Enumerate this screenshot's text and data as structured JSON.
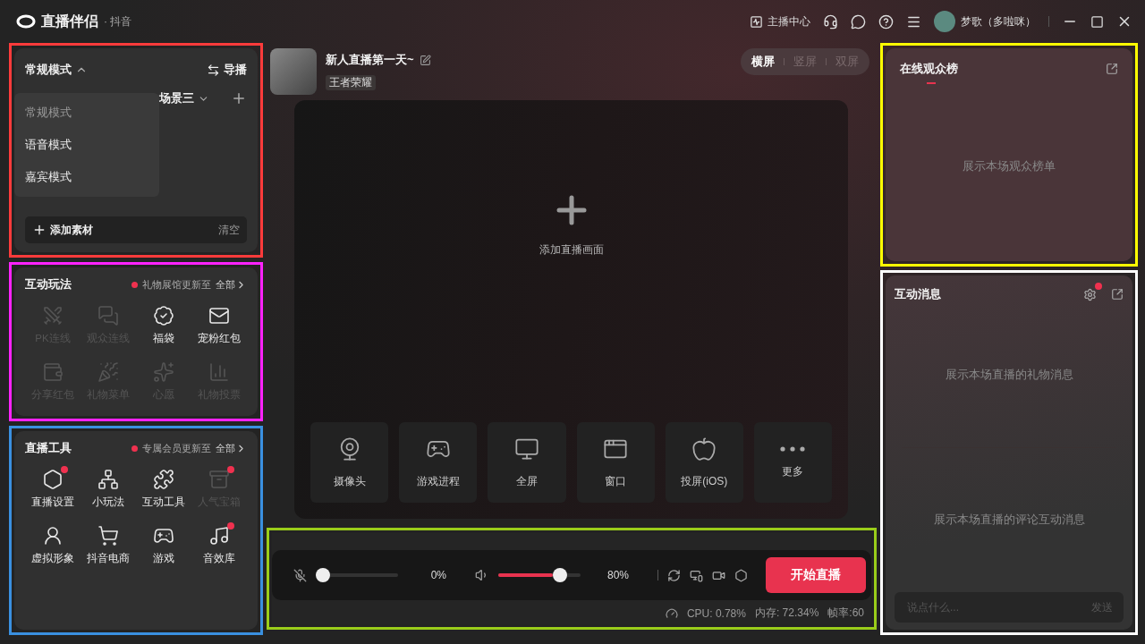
{
  "titlebar": {
    "app_name": "直播伴侣",
    "platform": "· 抖音",
    "anchor_center": "主播中心",
    "user_name": "梦歌（多啦咪）"
  },
  "scene_panel": {
    "mode": "常规模式",
    "mode_menu_expanded": true,
    "director": "导播",
    "scene_tab": "场景三",
    "mode_menu": [
      {
        "label": "常规模式",
        "selected": true
      },
      {
        "label": "语音模式",
        "selected": false
      },
      {
        "label": "嘉宾模式",
        "selected": false
      }
    ],
    "add_material": "添加素材",
    "clear": "清空"
  },
  "interactive_panel": {
    "title": "互动玩法",
    "notice": "礼物展馆更新至",
    "all": "全部",
    "items": [
      {
        "label": "PK连线",
        "disabled": true,
        "badge": false
      },
      {
        "label": "观众连线",
        "disabled": true,
        "badge": false
      },
      {
        "label": "福袋",
        "disabled": false,
        "badge": false
      },
      {
        "label": "宠粉红包",
        "disabled": false,
        "badge": false
      },
      {
        "label": "分享红包",
        "disabled": true,
        "badge": false
      },
      {
        "label": "礼物菜单",
        "disabled": true,
        "badge": false
      },
      {
        "label": "心愿",
        "disabled": true,
        "badge": false
      },
      {
        "label": "礼物投票",
        "disabled": true,
        "badge": false
      }
    ]
  },
  "tools_panel": {
    "title": "直播工具",
    "notice": "专属会员更新至",
    "all": "全部",
    "items": [
      {
        "label": "直播设置",
        "disabled": false,
        "badge": true
      },
      {
        "label": "小玩法",
        "disabled": false,
        "badge": false
      },
      {
        "label": "互动工具",
        "disabled": false,
        "badge": false
      },
      {
        "label": "人气宝箱",
        "disabled": true,
        "badge": true
      },
      {
        "label": "虚拟形象",
        "disabled": false,
        "badge": false
      },
      {
        "label": "抖音电商",
        "disabled": false,
        "badge": false
      },
      {
        "label": "游戏",
        "disabled": false,
        "badge": false
      },
      {
        "label": "音效库",
        "disabled": false,
        "badge": true
      }
    ]
  },
  "stream": {
    "title": "新人直播第一天~",
    "category": "王者荣耀",
    "orientation_tabs": [
      {
        "label": "横屏",
        "selected": true
      },
      {
        "label": "竖屏",
        "selected": false
      },
      {
        "label": "双屏",
        "selected": false
      }
    ],
    "add_scene": "添加直播画面",
    "sources": [
      "摄像头",
      "游戏进程",
      "全屏",
      "窗口",
      "投屏(iOS)",
      "更多"
    ]
  },
  "control_bar": {
    "mic": {
      "muted": true,
      "level": 0,
      "reading": "0%"
    },
    "speaker": {
      "level": 0.8,
      "reading": "80%"
    },
    "start": "开始直播",
    "status": [
      "CPU: 0.78%",
      "内存: 72.34%",
      "帧率:60"
    ]
  },
  "viewers_panel": {
    "title": "在线观众榜",
    "empty": "展示本场观众榜单"
  },
  "messages_panel": {
    "title": "互动消息",
    "settings_badge": true,
    "gift_empty": "展示本场直播的礼物消息",
    "comment_empty": "展示本场直播的评论互动消息",
    "input_placeholder": "说点什么...",
    "send": "发送"
  }
}
